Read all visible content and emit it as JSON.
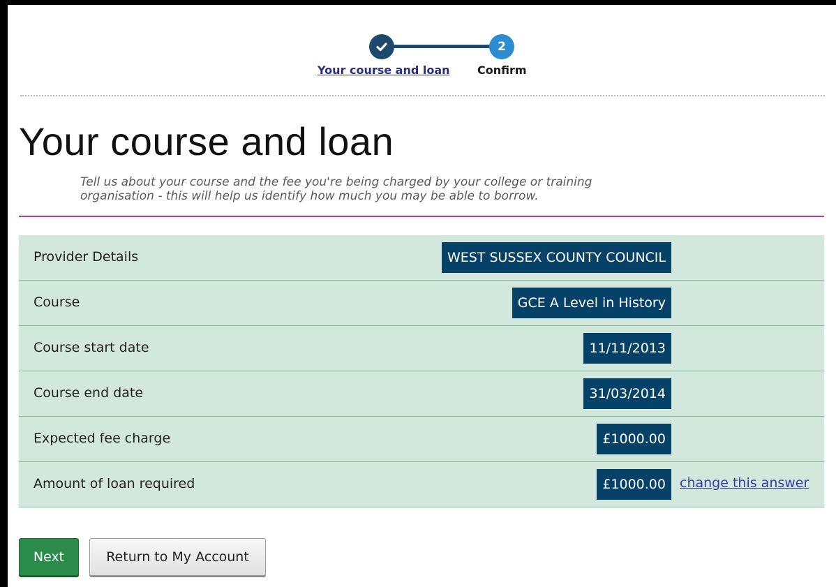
{
  "stepper": {
    "steps": [
      {
        "label": "Your course and loan",
        "state": "complete",
        "icon": "check-icon"
      },
      {
        "label": "Confirm",
        "state": "current",
        "number": "2"
      }
    ]
  },
  "page": {
    "title": "Your course and loan",
    "intro": "Tell us about your course and the fee you're being charged by your college or training organisation - this will help us identify how much you may be able to borrow."
  },
  "summary": {
    "rows": [
      {
        "label": "Provider Details",
        "value": "WEST SUSSEX COUNTY COUNCIL"
      },
      {
        "label": "Course",
        "value": "GCE A Level in History"
      },
      {
        "label": "Course start date",
        "value": "11/11/2013"
      },
      {
        "label": "Course end date",
        "value": "31/03/2014"
      },
      {
        "label": "Expected fee charge",
        "value": "£1000.00"
      },
      {
        "label": "Amount of loan required",
        "value": "£1000.00",
        "link": "change this answer"
      }
    ]
  },
  "actions": {
    "next_label": "Next",
    "return_label": "Return to My Account"
  },
  "colors": {
    "step_complete": "#1d4a6c",
    "step_current": "#2d8cd0",
    "accent_rule": "#c0378e",
    "table_bg": "#d3e8dc",
    "value_bg": "#064168",
    "next_button": "#2a8b4a"
  }
}
